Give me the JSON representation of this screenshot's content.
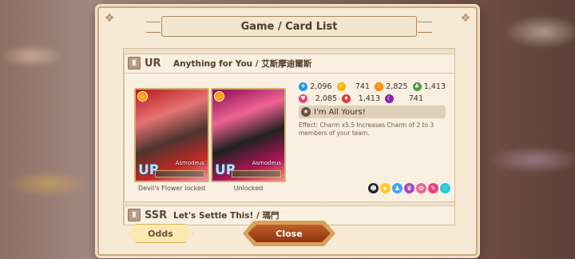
{
  "dialog": {
    "title": "Game / Card List",
    "odds_label": "Odds",
    "close_label": "Close"
  },
  "cards": [
    {
      "rarity": "UR",
      "name": "Anything for You / 艾斯摩迪爾斯",
      "images": [
        {
          "caption": "Devil's Flower locked",
          "tier": "UR",
          "character": "Asmodeus"
        },
        {
          "caption": "Unlocked",
          "tier": "UR",
          "character": "Asmodeus"
        }
      ],
      "stats": [
        {
          "icon": "snowflake-icon",
          "value": "2,096",
          "color": "#2196f3"
        },
        {
          "icon": "sun-icon",
          "value": "741",
          "color": "#ffb300"
        },
        {
          "icon": "flame-icon",
          "value": "2,825",
          "color": "#fb8c00"
        },
        {
          "icon": "leaf-icon",
          "value": "1,413",
          "color": "#43a047"
        },
        {
          "icon": "heart-icon",
          "value": "2,085",
          "color": "#ec407a"
        },
        {
          "icon": "fire-icon",
          "value": "1,413",
          "color": "#e53935"
        },
        {
          "icon": "moon-icon",
          "value": "741",
          "color": "#8e24aa"
        }
      ],
      "skill": {
        "name": "I'm All Yours!",
        "effect": "Effect: Charm x5.5 Increases Charm of 2 to 3 members of your team."
      }
    },
    {
      "rarity": "SSR",
      "name": "Let's Settle This! / 瑪門"
    }
  ]
}
